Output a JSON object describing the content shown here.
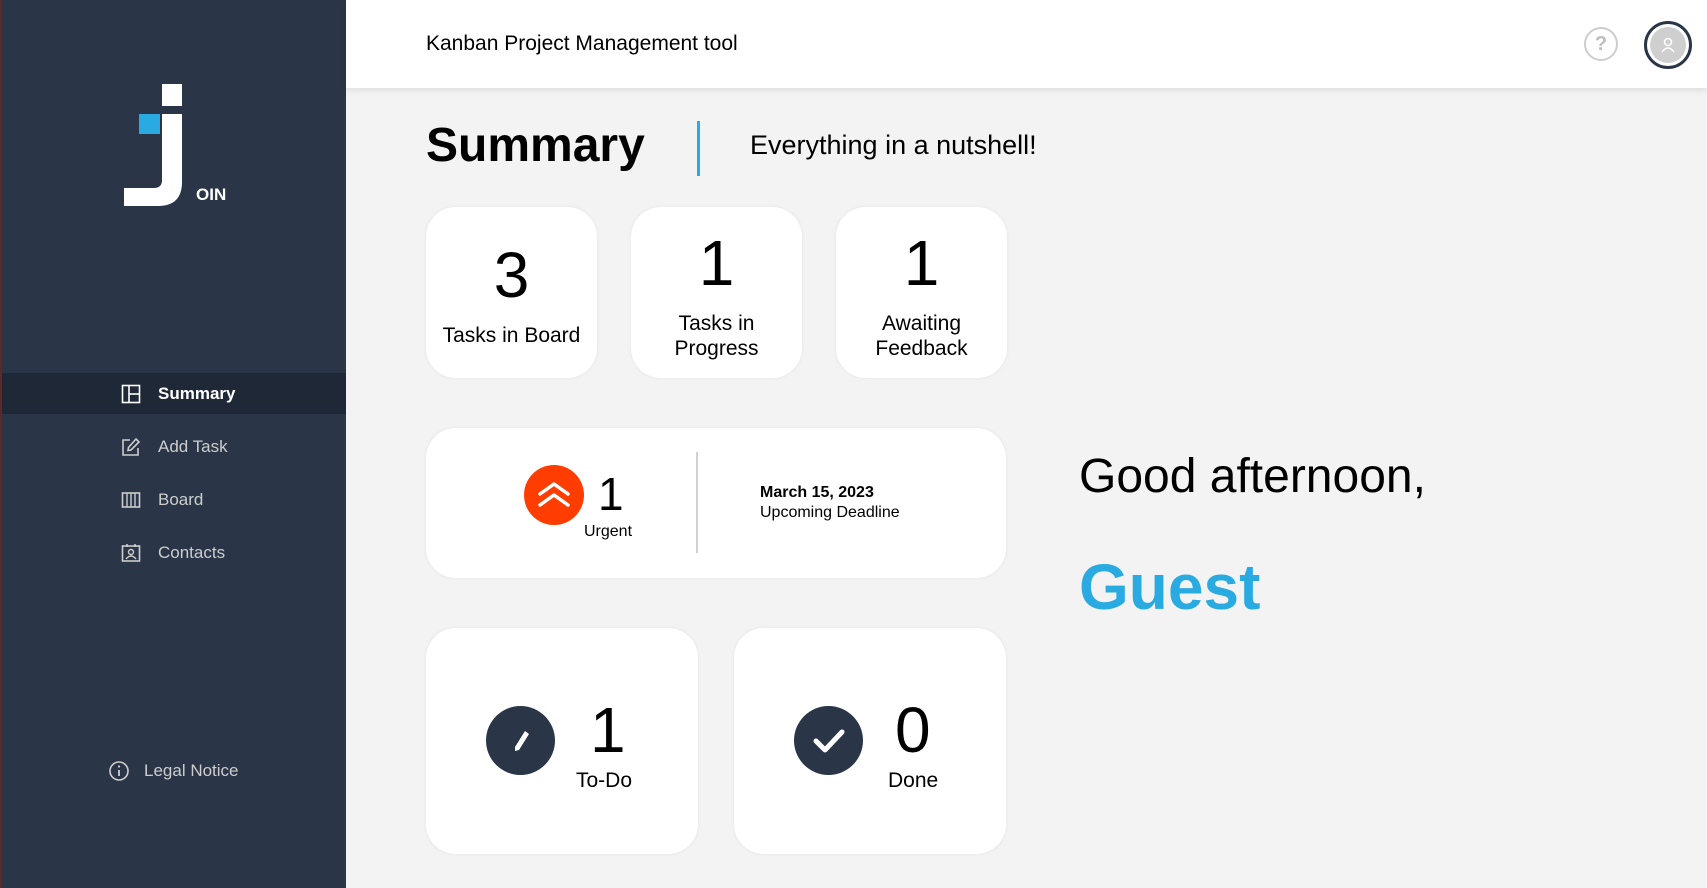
{
  "app": {
    "header_title": "Kanban Project Management tool",
    "help_symbol": "?",
    "logo_letters": "OIN"
  },
  "colors": {
    "sidebar": "#2a3647",
    "accent": "#29abe2",
    "urgent": "#ff3d00",
    "background": "#f3f3f3"
  },
  "sidebar": {
    "items": [
      {
        "label": "Summary",
        "icon": "summary-icon",
        "active": true
      },
      {
        "label": "Add Task",
        "icon": "edit-icon"
      },
      {
        "label": "Board",
        "icon": "board-icon"
      },
      {
        "label": "Contacts",
        "icon": "contacts-icon"
      }
    ],
    "legal": {
      "label": "Legal Notice",
      "icon": "info-icon"
    }
  },
  "page": {
    "title": "Summary",
    "subtitle": "Everything in a nutshell!"
  },
  "stats": {
    "board": {
      "count": "3",
      "label": "Tasks in Board"
    },
    "progress": {
      "count": "1",
      "label_line1": "Tasks in",
      "label_line2": "Progress"
    },
    "feedback": {
      "count": "1",
      "label_line1": "Awaiting",
      "label_line2": "Feedback"
    },
    "urgent": {
      "count": "1",
      "label": "Urgent",
      "icon": "urgent-arrows-icon"
    },
    "deadline": {
      "date": "March 15, 2023",
      "label": "Upcoming Deadline"
    },
    "todo": {
      "count": "1",
      "label": "To-Do",
      "icon": "pencil-icon"
    },
    "done": {
      "count": "0",
      "label": "Done",
      "icon": "check-icon"
    }
  },
  "greeting": {
    "text": "Good afternoon,",
    "name": "Guest"
  }
}
